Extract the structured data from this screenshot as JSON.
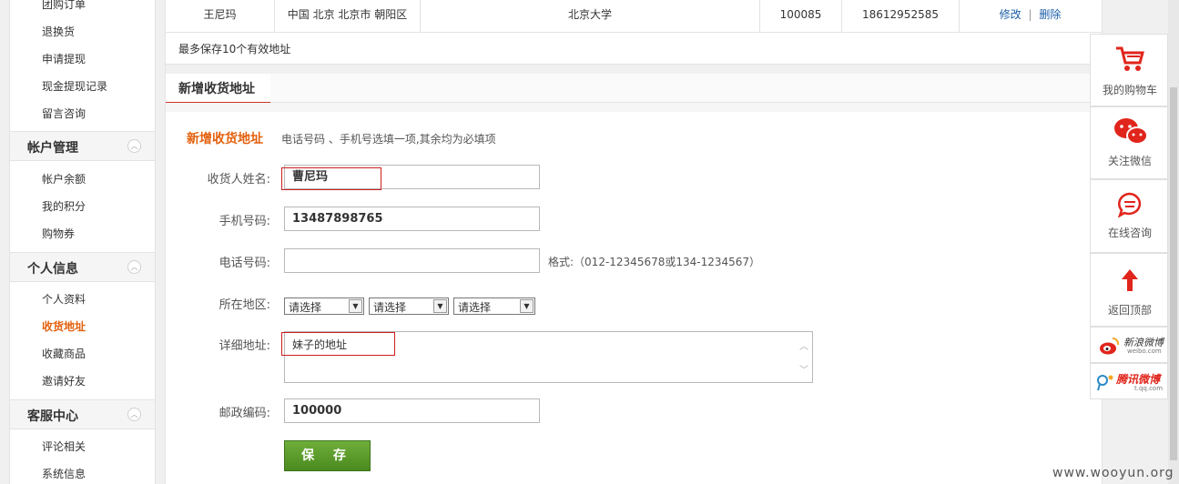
{
  "sidebar": {
    "top_links": [
      "团购订单",
      "退换货",
      "申请提现",
      "现金提现记录",
      "留言咨询"
    ],
    "groups": [
      {
        "title": "帐户管理",
        "items": [
          "帐户余额",
          "我的积分",
          "购物券"
        ]
      },
      {
        "title": "个人信息",
        "items": [
          "个人资料",
          "收货地址",
          "收藏商品",
          "邀请好友"
        ]
      },
      {
        "title": "客服中心",
        "items": [
          "评论相关",
          "系统信息"
        ]
      }
    ],
    "active_item": "收货地址"
  },
  "address_row": {
    "name": "王尼玛",
    "region": "中国 北京 北京市 朝阳区",
    "street": "北京大学",
    "zip": "100085",
    "phone": "18612952585",
    "edit_label": "修改",
    "separator": "|",
    "delete_label": "删除"
  },
  "limit_note": "最多保存10个有效地址",
  "tab": {
    "label": "新增收货地址"
  },
  "form": {
    "title": "新增收货地址",
    "hint": "电话号码 、手机号选填一项,其余均为必填项",
    "name_label": "收货人姓名:",
    "name_value": "曹尼玛",
    "mobile_label": "手机号码:",
    "mobile_value": "13487898765",
    "phone_label": "电话号码:",
    "phone_value": "",
    "phone_format": "格式:（012-12345678或134-1234567）",
    "region_label": "所在地区:",
    "region_selects": [
      "请选择",
      "请选择",
      "请选择"
    ],
    "detail_label": "详细地址:",
    "detail_value": "妹子的地址",
    "zip_label": "邮政编码:",
    "zip_value": "100000",
    "save_label": "保 存"
  },
  "float_bar": {
    "cart": "我的购物车",
    "wechat": "关注微信",
    "consult": "在线咨询",
    "top": "返回顶部",
    "weibo_text": "新浪微博",
    "weibo_domain": "weibo.com",
    "tqq_text": "腾讯微博",
    "tqq_domain": "t.qq.com"
  },
  "watermark": "www.wooyun.org",
  "colors": {
    "accent_orange": "#e3610f",
    "link_blue": "#1b5fa8",
    "save_green": "#5a9a2c",
    "brand_red": "#e0251c",
    "highlight_red": "#cc1e1e"
  }
}
